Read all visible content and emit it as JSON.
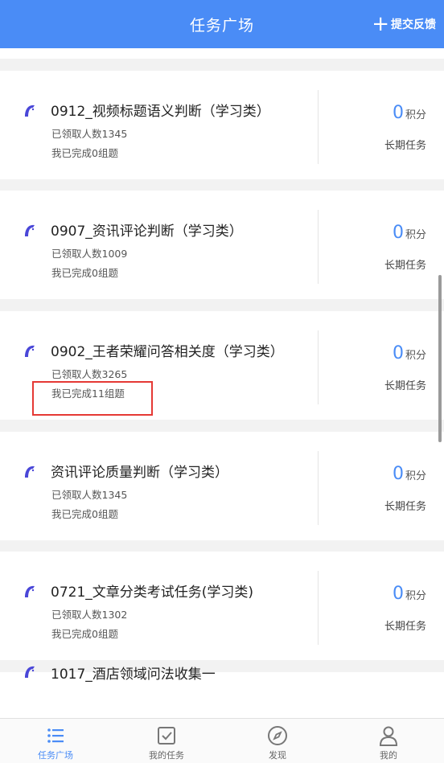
{
  "header": {
    "title": "任务广场",
    "feedback_label": "提交反馈"
  },
  "tasks": [
    {
      "title": "0912_视频标题语义判断（学习类）",
      "claimed": "已领取人数1345",
      "completed": "我已完成0组题",
      "points": "0",
      "points_unit": "积分",
      "duration": "长期任务"
    },
    {
      "title": "0907_资讯评论判断（学习类）",
      "claimed": "已领取人数1009",
      "completed": "我已完成0组题",
      "points": "0",
      "points_unit": "积分",
      "duration": "长期任务"
    },
    {
      "title": "0902_王者荣耀问答相关度（学习类）",
      "claimed": "已领取人数3265",
      "completed": "我已完成11组题",
      "points": "0",
      "points_unit": "积分",
      "duration": "长期任务"
    },
    {
      "title": "资讯评论质量判断（学习类）",
      "claimed": "已领取人数1345",
      "completed": "我已完成0组题",
      "points": "0",
      "points_unit": "积分",
      "duration": "长期任务"
    },
    {
      "title": "0721_文章分类考试任务(学习类)",
      "claimed": "已领取人数1302",
      "completed": "我已完成0组题",
      "points": "0",
      "points_unit": "积分",
      "duration": "长期任务"
    }
  ],
  "partial_task": {
    "title": "1017_酒店领域问法收集一"
  },
  "tabs": [
    {
      "label": "任务广场",
      "icon": "list-icon",
      "active": true
    },
    {
      "label": "我的任务",
      "icon": "checkbox-icon",
      "active": false
    },
    {
      "label": "发现",
      "icon": "compass-icon",
      "active": false
    },
    {
      "label": "我的",
      "icon": "person-icon",
      "active": false
    }
  ],
  "colors": {
    "primary": "#4a8cf6",
    "highlight_border": "#e53935",
    "task_icon": "#4a47d8"
  }
}
